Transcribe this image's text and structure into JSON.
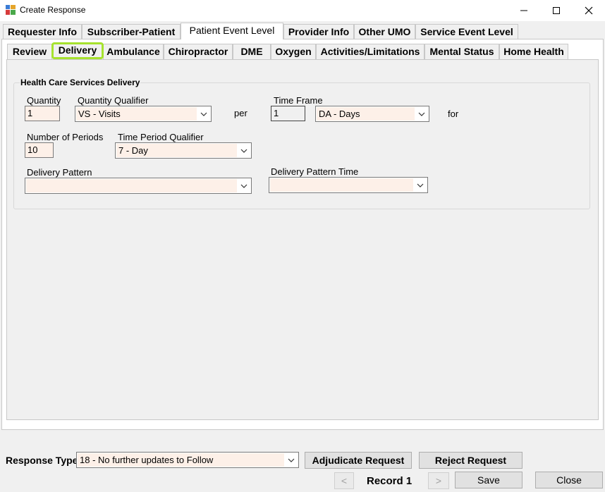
{
  "window": {
    "title": "Create Response"
  },
  "main_tabs": [
    {
      "label": "Requester Info"
    },
    {
      "label": "Subscriber-Patient"
    },
    {
      "label": "Patient Event Level"
    },
    {
      "label": "Provider Info"
    },
    {
      "label": "Other UMO"
    },
    {
      "label": "Service Event Level"
    }
  ],
  "sub_tabs": [
    {
      "label": "Review"
    },
    {
      "label": "Delivery"
    },
    {
      "label": "Ambulance"
    },
    {
      "label": "Chiropractor"
    },
    {
      "label": "DME"
    },
    {
      "label": "Oxygen"
    },
    {
      "label": "Activities/Limitations"
    },
    {
      "label": "Mental Status"
    },
    {
      "label": "Home Health"
    }
  ],
  "delivery": {
    "group_title": "Health Care Services Delivery",
    "quantity": {
      "label": "Quantity",
      "value": "1"
    },
    "quantity_qualifier": {
      "label": "Quantity Qualifier",
      "value": "VS - Visits"
    },
    "per_label": "per",
    "time_frame": {
      "label": "Time Frame",
      "value": "1"
    },
    "time_frame_unit": {
      "value": "DA - Days"
    },
    "for_label": "for",
    "number_of_periods": {
      "label": "Number of Periods",
      "value": "10"
    },
    "time_period_qualifier": {
      "label": "Time Period Qualifier",
      "value": "7 - Day"
    },
    "delivery_pattern": {
      "label": "Delivery Pattern",
      "value": ""
    },
    "delivery_pattern_time": {
      "label": "Delivery Pattern Time",
      "value": ""
    }
  },
  "footer": {
    "response_type_label": "Response Type",
    "response_type_value": "18 - No further updates to Follow",
    "adjudicate_label": "Adjudicate Request",
    "reject_label": "Reject Request",
    "prev_label": "<",
    "record_label": "Record 1",
    "next_label": ">",
    "save_label": "Save",
    "close_label": "Close"
  },
  "colors": {
    "active_subtab_highlight": "#a6e22e",
    "field_bg": "#fdf0e8"
  },
  "icons": [
    "app-icon",
    "minimize-icon",
    "maximize-icon",
    "close-icon",
    "chevron-down-icon"
  ]
}
